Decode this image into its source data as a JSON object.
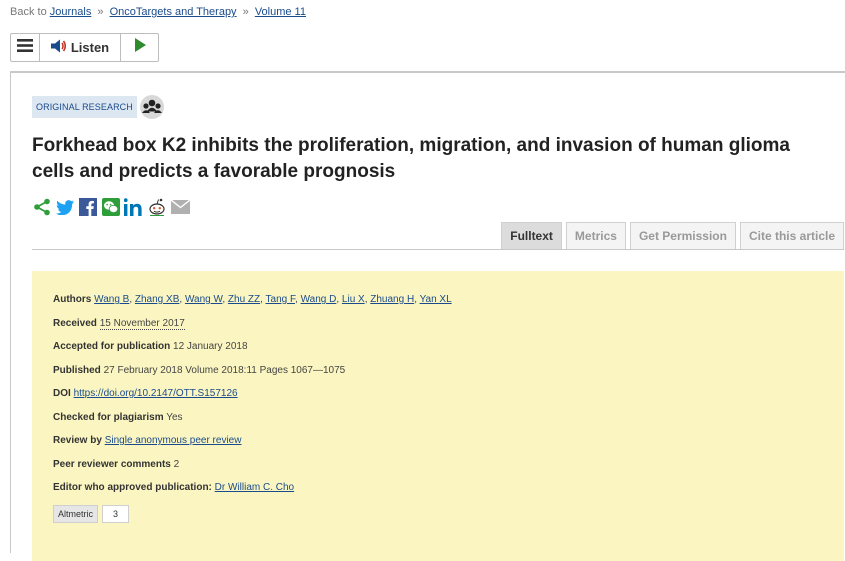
{
  "breadcrumb": {
    "prefix": "Back to",
    "journals": "Journals",
    "journal": "OncoTargets and Therapy",
    "volume": "Volume 11",
    "separator": "»"
  },
  "player": {
    "listen_label": "Listen"
  },
  "article": {
    "type_badge": "ORIGINAL RESEARCH",
    "title": "Forkhead box K2 inhibits the proliferation, migration, and invasion of human glioma cells and predicts a favorable prognosis"
  },
  "share_icons": [
    "share-icon",
    "twitter-icon",
    "facebook-icon",
    "wechat-icon",
    "linkedin-icon",
    "reddit-icon",
    "email-icon"
  ],
  "tabs": [
    {
      "label": "Fulltext",
      "active": true
    },
    {
      "label": "Metrics",
      "active": false
    },
    {
      "label": "Get Permission",
      "active": false
    },
    {
      "label": "Cite this article",
      "active": false
    }
  ],
  "meta": {
    "authors_label": "Authors",
    "authors": [
      "Wang B",
      "Zhang XB",
      "Wang W",
      "Zhu ZZ",
      "Tang F",
      "Wang D",
      "Liu X",
      "Zhuang H",
      "Yan XL"
    ],
    "received_label": "Received",
    "received": "15 November 2017",
    "accepted_label": "Accepted for publication",
    "accepted": "12 January 2018",
    "published_label": "Published",
    "published": "27 February 2018 Volume 2018:11 Pages 1067—1075",
    "doi_label": "DOI",
    "doi": "https://doi.org/10.2147/OTT.S157126",
    "plagiarism_label": "Checked for plagiarism",
    "plagiarism": "Yes",
    "review_label": "Review by",
    "review": "Single anonymous peer review",
    "comments_label": "Peer reviewer comments",
    "comments": "2",
    "editor_label": "Editor who approved publication:",
    "editor": "Dr William C. Cho",
    "altmetric_label": "Altmetric",
    "altmetric_score": "3"
  },
  "colors": {
    "link": "#1a4b8c",
    "meta_background": "#fbf6c1",
    "play": "#2e8b2e",
    "share_green": "#2e9e3a",
    "twitter": "#1da1f2",
    "facebook": "#3b5998",
    "linkedin": "#0077b5"
  }
}
